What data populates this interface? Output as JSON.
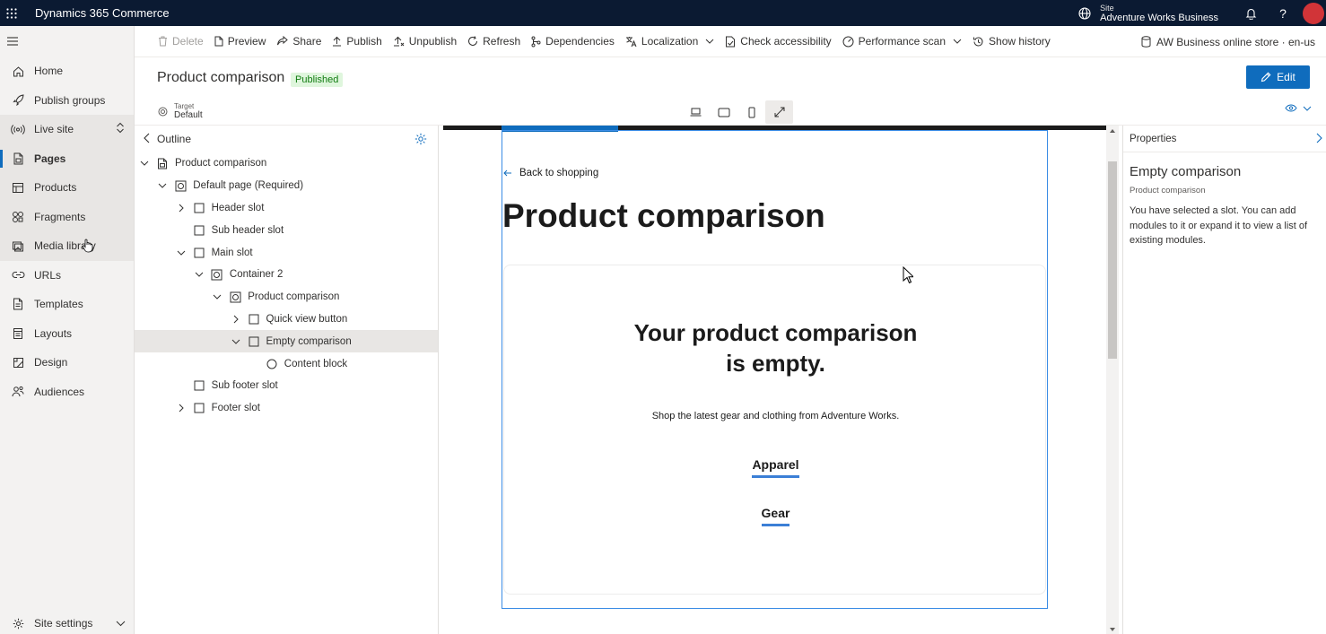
{
  "app": {
    "title": "Dynamics 365 Commerce"
  },
  "topbar": {
    "site_label": "Site",
    "site_name": "Adventure Works Business",
    "icons": [
      "waffle-icon",
      "globe-icon",
      "bell-icon",
      "help-icon",
      "avatar"
    ]
  },
  "nav": {
    "items": [
      {
        "label": "Home",
        "icon": "home-icon"
      },
      {
        "label": "Publish groups",
        "icon": "rocket-icon"
      },
      {
        "label": "Live site",
        "icon": "broadcast-icon"
      },
      {
        "label": "Pages",
        "icon": "page-icon"
      },
      {
        "label": "Products",
        "icon": "product-icon"
      },
      {
        "label": "Fragments",
        "icon": "fragments-icon"
      },
      {
        "label": "Media library",
        "icon": "image-icon"
      },
      {
        "label": "URLs",
        "icon": "link-icon"
      },
      {
        "label": "Templates",
        "icon": "template-icon"
      },
      {
        "label": "Layouts",
        "icon": "layout-icon"
      },
      {
        "label": "Design",
        "icon": "design-icon"
      },
      {
        "label": "Audiences",
        "icon": "audience-icon"
      }
    ],
    "bottom": {
      "label": "Site settings",
      "icon": "gear-icon"
    }
  },
  "commands": {
    "delete": "Delete",
    "preview": "Preview",
    "share": "Share",
    "publish": "Publish",
    "unpublish": "Unpublish",
    "refresh": "Refresh",
    "dependencies": "Dependencies",
    "localization": "Localization",
    "check_accessibility": "Check accessibility",
    "performance_scan": "Performance scan",
    "show_history": "Show history",
    "store": "AW Business online store · en-us"
  },
  "page": {
    "title": "Product comparison",
    "status": "Published",
    "edit_label": "Edit"
  },
  "target": {
    "label": "Target",
    "value": "Default"
  },
  "outline": {
    "title": "Outline",
    "tree": [
      {
        "label": "Product comparison",
        "depth": 0,
        "expander": "down",
        "icon": "page"
      },
      {
        "label": "Default page (Required)",
        "depth": 1,
        "expander": "down",
        "icon": "module"
      },
      {
        "label": "Header slot",
        "depth": 2,
        "expander": "right",
        "icon": "slot"
      },
      {
        "label": "Sub header slot",
        "depth": 2,
        "expander": "none",
        "icon": "slot"
      },
      {
        "label": "Main slot",
        "depth": 2,
        "expander": "down",
        "icon": "slot"
      },
      {
        "label": "Container 2",
        "depth": 3,
        "expander": "down",
        "icon": "module"
      },
      {
        "label": "Product comparison",
        "depth": 4,
        "expander": "down",
        "icon": "module"
      },
      {
        "label": "Quick view button",
        "depth": 5,
        "expander": "right",
        "icon": "slot"
      },
      {
        "label": "Empty comparison",
        "depth": 5,
        "expander": "down",
        "icon": "slot",
        "selected": true
      },
      {
        "label": "Content block",
        "depth": 6,
        "expander": "none",
        "icon": "circle"
      },
      {
        "label": "Sub footer slot",
        "depth": 2,
        "expander": "none",
        "icon": "slot"
      },
      {
        "label": "Footer slot",
        "depth": 2,
        "expander": "right",
        "icon": "slot"
      }
    ]
  },
  "canvas": {
    "back_link": "Back to shopping",
    "heading": "Product comparison",
    "empty_title_line1": "Your product comparison",
    "empty_title_line2": "is empty.",
    "empty_subtitle": "Shop the latest gear and clothing from Adventure Works.",
    "links": [
      "Apparel",
      "Gear"
    ],
    "accent_color": "#3b7fd6"
  },
  "properties": {
    "header": "Properties",
    "title": "Empty comparison",
    "subtitle": "Product comparison",
    "description": "You have selected a slot. You can add modules to it or expand it to view a list of existing modules."
  },
  "colors": {
    "topbar": "#0b1a32",
    "primary": "#0f6cbd",
    "published_bg": "#dff6dd",
    "published_fg": "#107c10"
  }
}
